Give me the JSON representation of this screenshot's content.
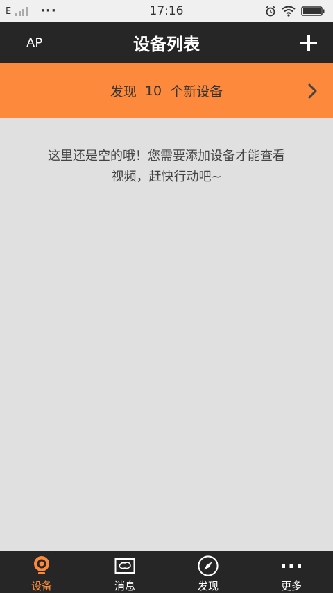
{
  "status_bar": {
    "network": "E",
    "time": "17:16"
  },
  "header": {
    "left_label": "AP",
    "title": "设备列表",
    "add_icon": "plus-icon"
  },
  "banner": {
    "prefix": "发现",
    "count": "10",
    "suffix": "个新设备",
    "chevron_icon": "chevron-right-icon"
  },
  "empty": {
    "line1": "这里还是空的哦！您需要添加设备才能查看",
    "line2": "视频，赶快行动吧~"
  },
  "tabs": [
    {
      "label": "设备",
      "icon": "camera-icon",
      "active": true
    },
    {
      "label": "消息",
      "icon": "message-icon",
      "active": false
    },
    {
      "label": "发现",
      "icon": "compass-icon",
      "active": false
    },
    {
      "label": "更多",
      "icon": "more-icon",
      "active": false
    }
  ],
  "colors": {
    "accent": "#fd8a3c",
    "header_bg": "#262626",
    "page_bg": "#e0e0e0"
  }
}
